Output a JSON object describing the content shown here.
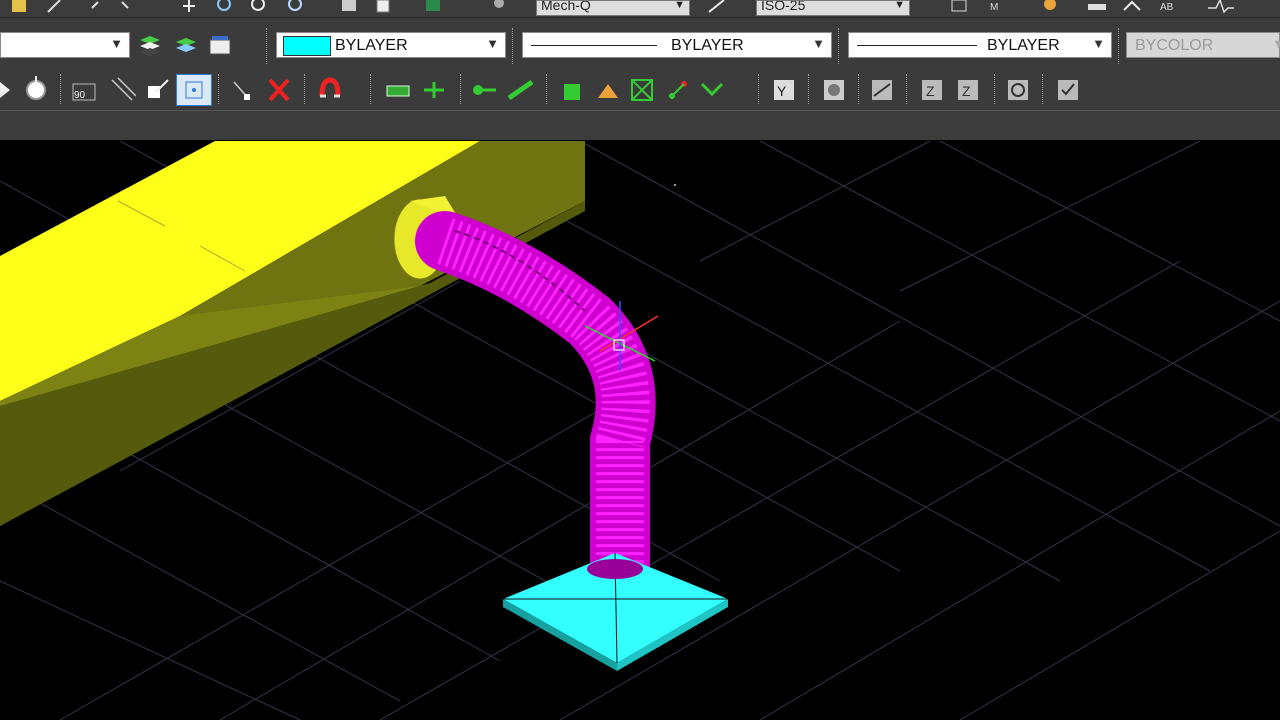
{
  "top_toolbar": {
    "dimstyle_combo": "Mech-Q",
    "textstyle_combo": "ISO-25",
    "icon_names": [
      "layer-icon",
      "edit-icon",
      "undo-icon",
      "move-icon",
      "zoom-icon",
      "zoom-realtime-icon",
      "zoom-window-icon",
      "save-icon",
      "properties-icon",
      "render-icon",
      "match-icon",
      "grid-icon",
      "measure-icon",
      "tool-icon",
      "spell-icon",
      "chart-icon"
    ]
  },
  "properties_toolbar": {
    "layer_value": "",
    "color_value": "BYLAYER",
    "linetype_value": "BYLAYER",
    "lineweight_value": "BYLAYER",
    "plotstyle_value": "BYCOLOR",
    "color_swatch": "#00ffff"
  },
  "snap_toolbar": {
    "tools": [
      "snap-endpoint-icon",
      "snap-center-icon",
      "snap-perpendicular-icon",
      "snap-parallel-icon",
      "snap-extension-icon",
      "snap-node-icon",
      "snap-nearest-icon",
      "snap-none-icon",
      "osnap-settings-icon",
      "duct-icon",
      "duct-connect-icon",
      "pipe-icon",
      "pipe-slope-icon",
      "fitting-icon",
      "elevation-icon",
      "tag-icon",
      "branch-icon",
      "mech-text-icon",
      "mech-edit-icon",
      "mech-door-icon",
      "mech-tee-icon",
      "mech-elbow-icon",
      "mech-settings-icon",
      "mech-check-icon"
    ],
    "active_tool": "snap-node-icon"
  },
  "viewport": {
    "background": "#000000",
    "colors": {
      "duct": "#ffff00",
      "flex_duct": "#d400d4",
      "diffuser": "#33ffff",
      "grid": "#5a5a7a"
    }
  }
}
